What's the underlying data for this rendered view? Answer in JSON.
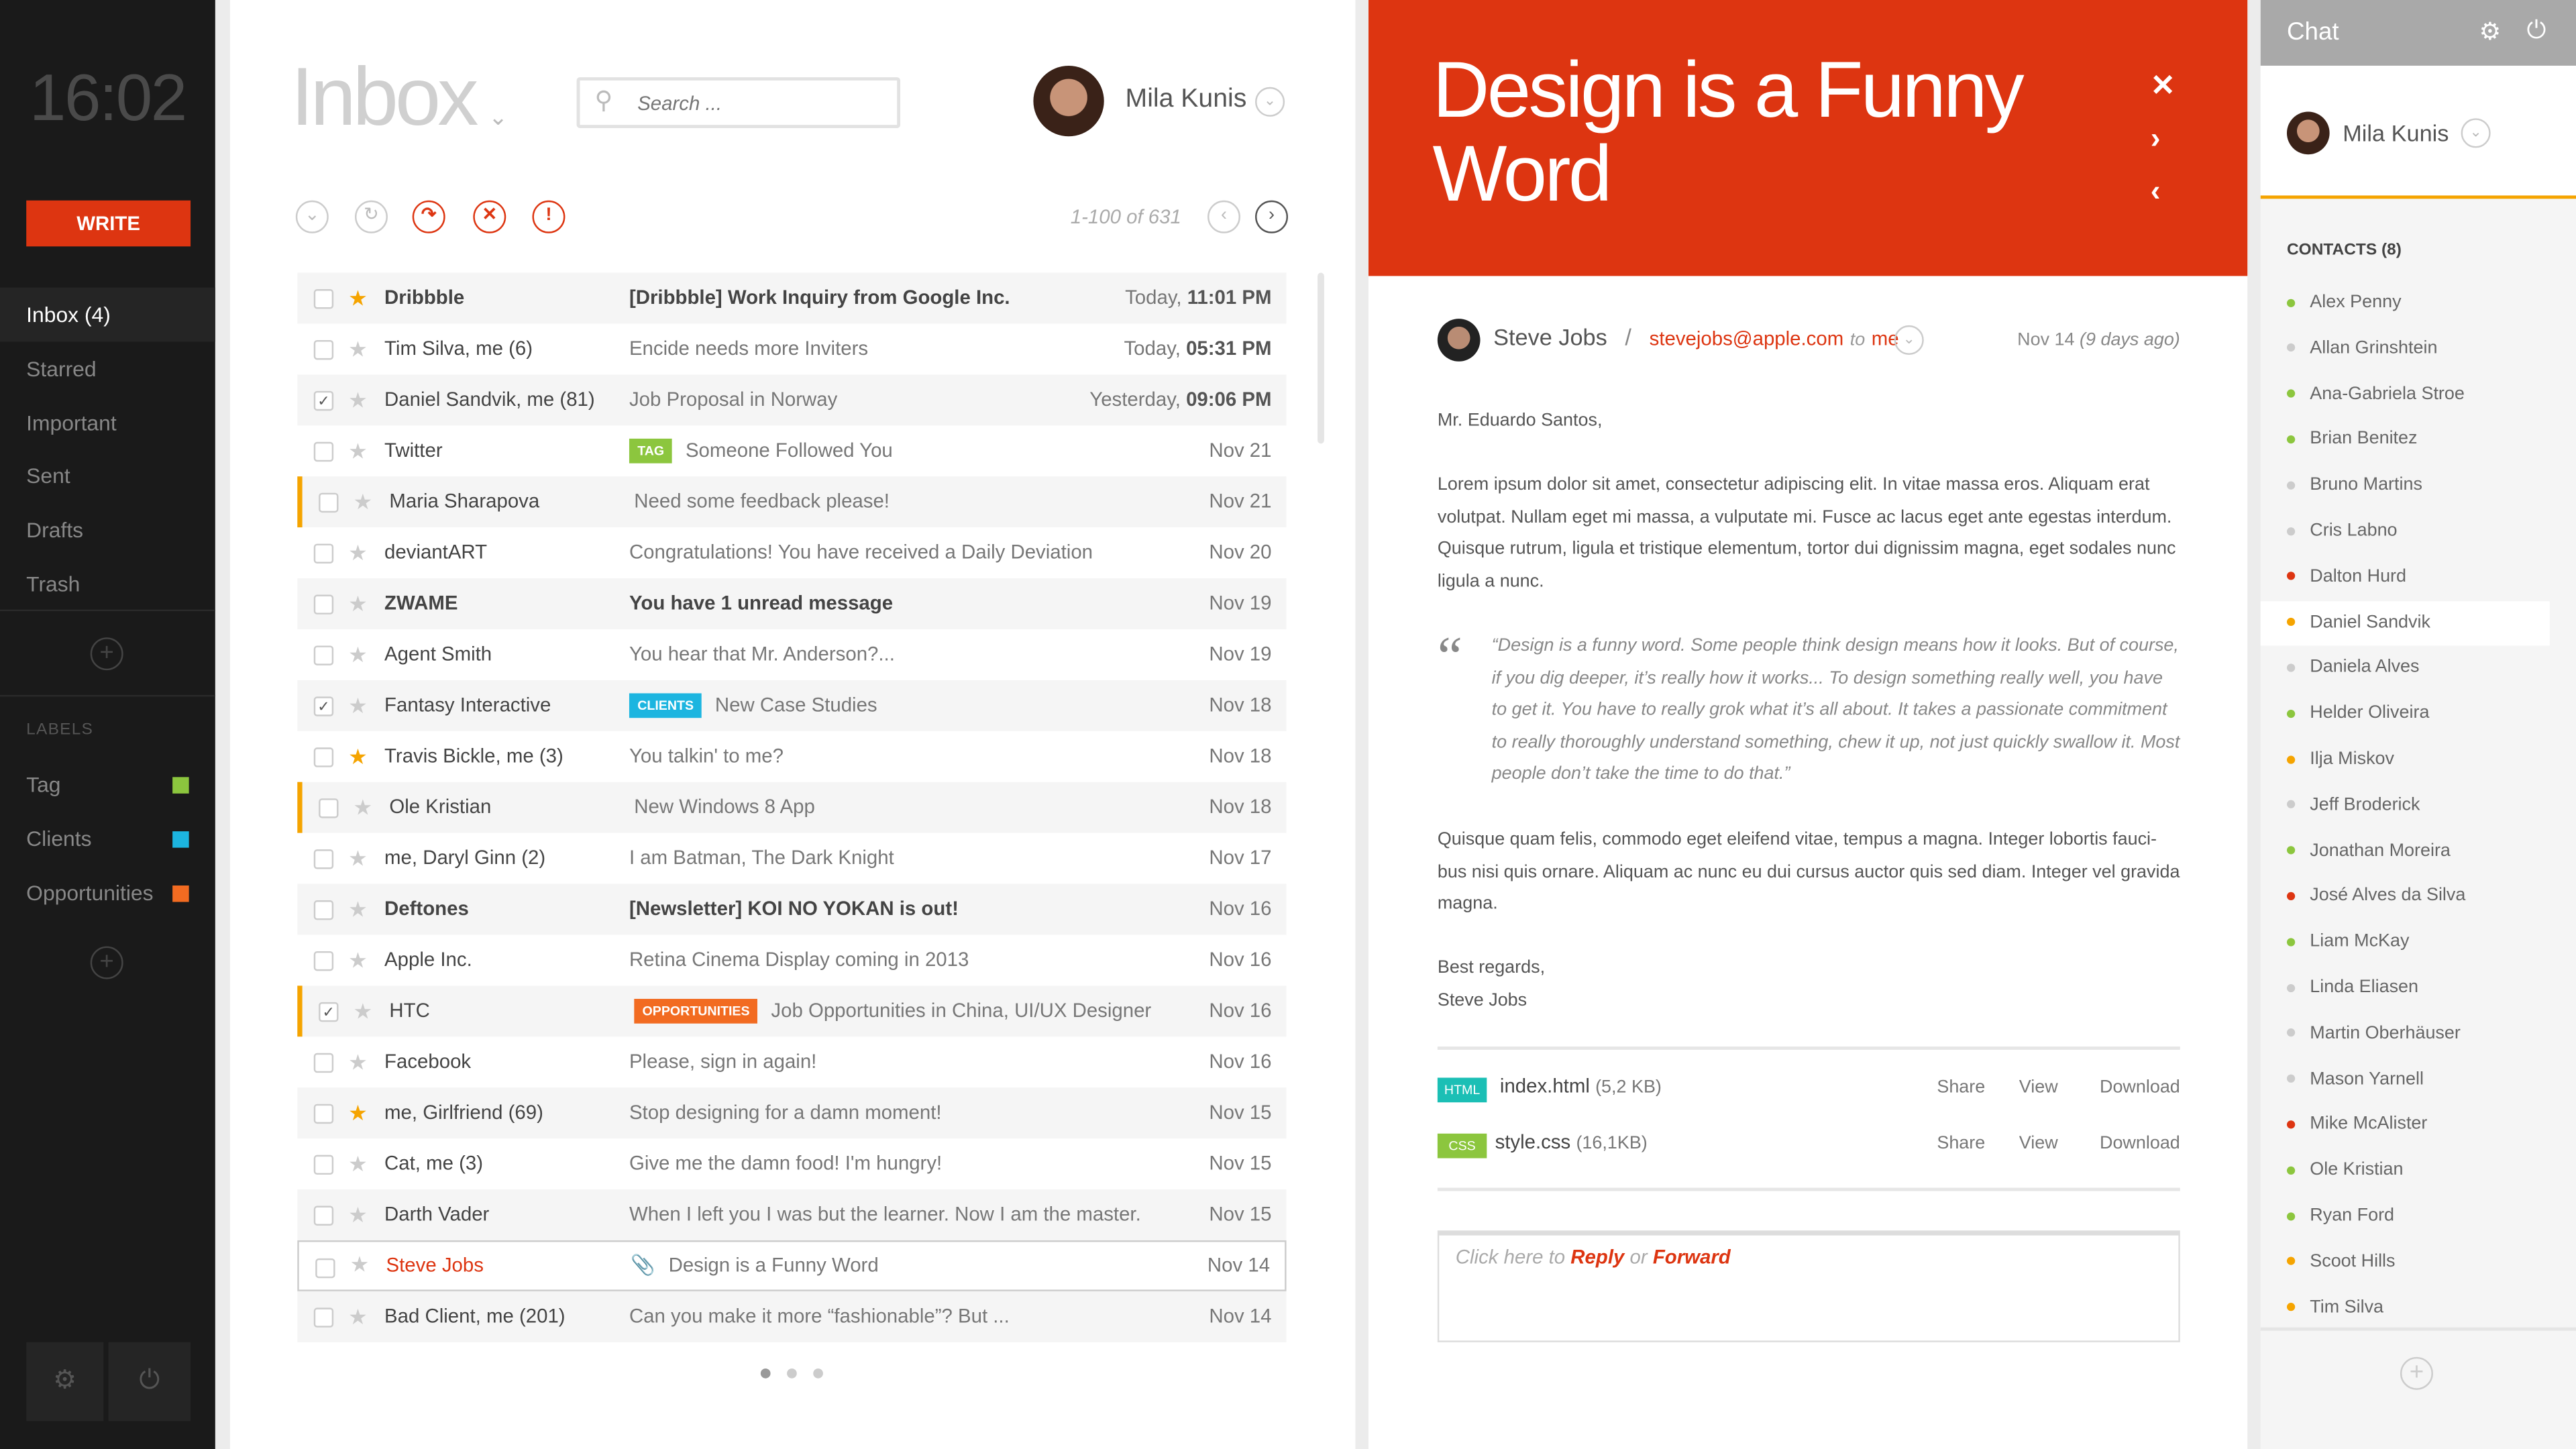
{
  "sidebar": {
    "clock": "16:02",
    "write": "WRITE",
    "nav": [
      {
        "label": "Inbox (4)",
        "active": true
      },
      {
        "label": "Starred"
      },
      {
        "label": "Important"
      },
      {
        "label": "Sent"
      },
      {
        "label": "Drafts"
      },
      {
        "label": "Trash"
      }
    ],
    "labels_heading": "LABELS",
    "labels": [
      {
        "label": "Tag",
        "color": "#8cc63e"
      },
      {
        "label": "Clients",
        "color": "#1cb5e0"
      },
      {
        "label": "Opportunities",
        "color": "#f26b21"
      }
    ]
  },
  "inbox": {
    "title": "Inbox",
    "search_placeholder": "Search ...",
    "user": "Mila Kunis",
    "pagination": "1-100 of 631",
    "emails": [
      {
        "sender": "Dribbble",
        "subject": "[Dribbble] Work Inquiry from Google Inc.",
        "date": "Today, ",
        "time": "11:01 PM",
        "starred": true,
        "unread": true
      },
      {
        "sender": "Tim Silva, me (6)",
        "subject": "Encide needs more Inviters",
        "date": "Today, ",
        "time": "05:31 PM"
      },
      {
        "sender": "Daniel Sandvik, me (81)",
        "subject": "Job Proposal in Norway",
        "date": "Yesterday, ",
        "time": "09:06 PM",
        "checked": true
      },
      {
        "sender": "Twitter",
        "tag": "TAG",
        "tag_color": "#8cc63e",
        "subject": "Someone Followed You",
        "date": "Nov 21"
      },
      {
        "sender": "Maria Sharapova",
        "subject": "Need some feedback please!",
        "date": "Nov 21",
        "flag": true
      },
      {
        "sender": "deviantART",
        "subject": "Congratulations! You have received a Daily Deviation",
        "date": "Nov 20"
      },
      {
        "sender": "ZWAME",
        "subject": "You have 1 unread message",
        "date": "Nov 19",
        "unread": true
      },
      {
        "sender": "Agent Smith",
        "subject": "You hear that Mr. Anderson?...",
        "date": "Nov 19"
      },
      {
        "sender": "Fantasy Interactive",
        "tag": "CLIENTS",
        "tag_color": "#1cb5e0",
        "subject": "New Case Studies",
        "date": "Nov 18",
        "checked": true
      },
      {
        "sender": "Travis Bickle, me (3)",
        "subject": "You talkin' to me?",
        "date": "Nov 18",
        "starred": true
      },
      {
        "sender": "Ole Kristian",
        "subject": "New Windows 8 App",
        "date": "Nov 18",
        "flag": true
      },
      {
        "sender": "me, Daryl Ginn (2)",
        "subject": "I am Batman, The Dark Knight",
        "date": "Nov 17"
      },
      {
        "sender": "Deftones",
        "subject": "[Newsletter] KOI NO YOKAN is out!",
        "date": "Nov 16",
        "unread": true
      },
      {
        "sender": "Apple Inc.",
        "subject": "Retina Cinema Display coming in 2013",
        "date": "Nov 16"
      },
      {
        "sender": "HTC",
        "tag": "OPPORTUNITIES",
        "tag_color": "#f26b21",
        "subject": "Job Opportunities in China, UI/UX Designer",
        "date": "Nov 16",
        "checked": true,
        "flag": true
      },
      {
        "sender": "Facebook",
        "subject": "Please, sign in again!",
        "date": "Nov 16"
      },
      {
        "sender": "me, Girlfriend (69)",
        "subject": "Stop designing for a damn moment!",
        "date": "Nov 15",
        "starred": true
      },
      {
        "sender": "Cat, me (3)",
        "subject": "Give me the damn food! I'm hungry!",
        "date": "Nov 15"
      },
      {
        "sender": "Darth Vader",
        "subject": "When I left you I was but the learner. Now I am the master.",
        "date": "Nov 15"
      },
      {
        "sender": "Steve Jobs",
        "subject": "Design is a Funny Word",
        "date": "Nov 14",
        "selected": true,
        "attachment": true
      },
      {
        "sender": "Bad Client, me (201)",
        "subject": "Can you make it more “fashionable”? But ...",
        "date": "Nov 14"
      }
    ]
  },
  "reader": {
    "title": "Design is a Funny Word",
    "from": "Steve Jobs",
    "email": "stevejobs@apple.com",
    "to_word": "to",
    "to": "me",
    "date": "Nov 14",
    "ago": "(9 days ago)",
    "greeting": "Mr. Eduardo Santos,",
    "p1": "Lorem ipsum dolor sit amet, consectetur adipiscing elit. In vitae massa eros. Aliquam erat volutpat. Nullam eget mi massa, a vulputate mi. Fusce ac lacus eget ante egestas interdum. Quisque rutrum, ligula et tristique elementum, tortor dui dignissim magna, eget sodales nunc ligula a nunc.",
    "quote": "“Design is a funny word. Some people think design means how it looks. But of course, if you dig deeper, it’s really how it works... To design something really well, you have to get it. You have to really grok what it’s all about. It takes a passionate commitment to really thoroughly understand something, chew it up, not just quickly swallow it. Most people don’t take the time to do that.”",
    "p2": "Quisque quam felis, commodo eget eleifend vitae, tempus a magna. Integer lobortis fauci-bus nisi quis ornare. Aliquam ac nunc eu dui cursus auctor quis sed diam. Integer vel gravida magna.",
    "sign1": "Best regards,",
    "sign2": "Steve Jobs",
    "attachments": [
      {
        "type": "HTML",
        "color": "#1bbfb5",
        "name": "index.html",
        "size": "(5,2 KB)"
      },
      {
        "type": "CSS",
        "color": "#8cc63e",
        "name": "style.css",
        "size": "(16,1KB)"
      }
    ],
    "actions": [
      "Share",
      "View",
      "Download"
    ],
    "reply": {
      "prefix": "Click here to ",
      "reply": "Reply",
      "or": " or ",
      "forward": "Forward"
    }
  },
  "chat": {
    "title": "Chat",
    "user": "Mila Kunis",
    "contacts_heading": "CONTACTS (8)",
    "contacts": [
      {
        "n": "Alex Penny",
        "s": "#8cc63e"
      },
      {
        "n": "Allan Grinshtein",
        "s": "#ccc"
      },
      {
        "n": "Ana-Gabriela Stroe",
        "s": "#8cc63e"
      },
      {
        "n": "Brian Benitez",
        "s": "#8cc63e"
      },
      {
        "n": "Bruno Martins",
        "s": "#ccc"
      },
      {
        "n": "Cris Labno",
        "s": "#ccc"
      },
      {
        "n": "Dalton Hurd",
        "s": "#dd3511"
      },
      {
        "n": "Daniel Sandvik",
        "s": "#f5a400",
        "hl": true
      },
      {
        "n": "Daniela Alves",
        "s": "#ccc"
      },
      {
        "n": "Helder Oliveira",
        "s": "#8cc63e"
      },
      {
        "n": "Ilja Miskov",
        "s": "#f5a400"
      },
      {
        "n": "Jeff Broderick",
        "s": "#ccc"
      },
      {
        "n": "Jonathan Moreira",
        "s": "#8cc63e"
      },
      {
        "n": "José Alves da Silva",
        "s": "#dd3511"
      },
      {
        "n": "Liam McKay",
        "s": "#8cc63e"
      },
      {
        "n": "Linda Eliasen",
        "s": "#ccc"
      },
      {
        "n": "Martin Oberhäuser",
        "s": "#ccc"
      },
      {
        "n": "Mason Yarnell",
        "s": "#ccc"
      },
      {
        "n": "Mike McAlister",
        "s": "#dd3511"
      },
      {
        "n": "Ole Kristian",
        "s": "#8cc63e"
      },
      {
        "n": "Ryan Ford",
        "s": "#8cc63e"
      },
      {
        "n": "Scoot Hills",
        "s": "#f5a400"
      },
      {
        "n": "Tim Silva",
        "s": "#f5a400"
      }
    ]
  },
  "colors": {
    "accent": "#dd3511",
    "flag": "#f5a400"
  }
}
